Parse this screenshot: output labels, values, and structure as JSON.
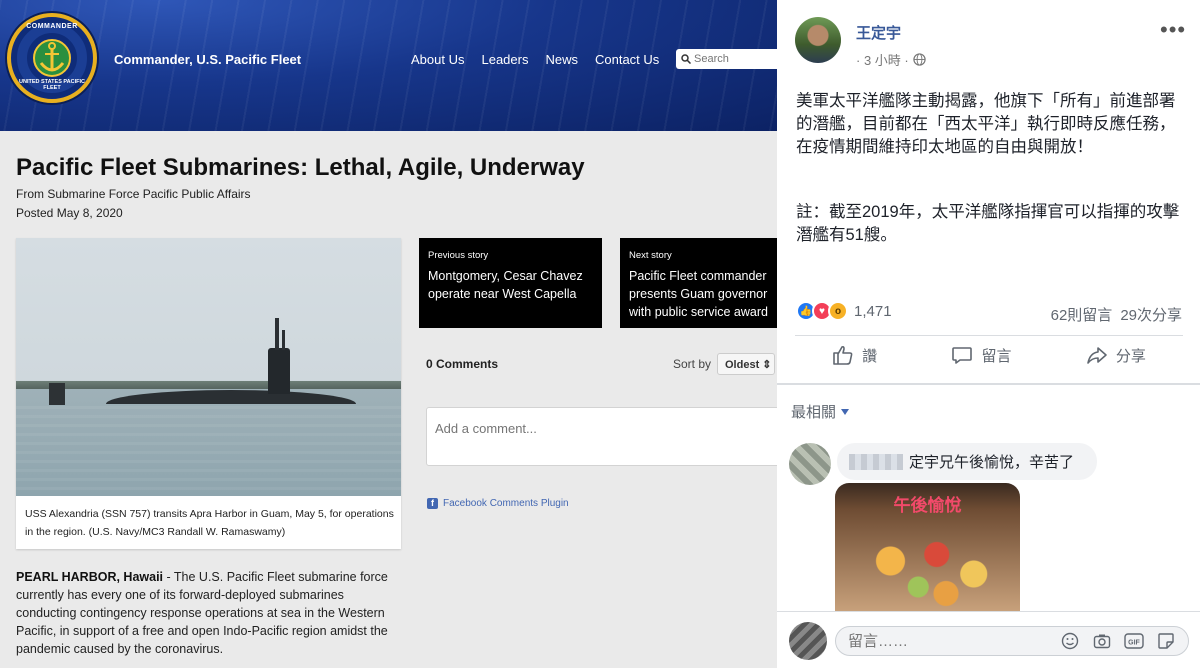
{
  "site": {
    "emblem_top": "COMMANDER",
    "emblem_bottom": "UNITED STATES PACIFIC FLEET",
    "name": "Commander, U.S. Pacific Fleet",
    "nav": [
      "About Us",
      "Leaders",
      "News",
      "Contact Us"
    ],
    "search_placeholder": "Search"
  },
  "article": {
    "title": "Pacific Fleet Submarines: Lethal, Agile, Underway",
    "byline": "From Submarine Force Pacific Public Affairs",
    "posted": "Posted May 8, 2020",
    "caption": "USS Alexandria (SSN 757) transits Apra Harbor in Guam, May 5, for operations in the region. (U.S. Navy/MC3 Randall W. Ramaswamy)",
    "dateline": "PEARL HARBOR, Hawaii",
    "body": " - The U.S. Pacific Fleet submarine force currently has every one of its forward-deployed submarines conducting contingency response operations at sea in the Western Pacific, in support of a free and open Indo-Pacific region amidst the pandemic caused by the coronavirus."
  },
  "stories": {
    "prev_label": "Previous story",
    "prev_title": "Montgomery, Cesar Chavez operate near West Capella",
    "next_label": "Next story",
    "next_title": "Pacific Fleet commander presents Guam governor with public service award"
  },
  "comments": {
    "count": "0 Comments",
    "sort_label": "Sort by",
    "sort_value": "Oldest",
    "placeholder": "Add a comment...",
    "plugin": "Facebook Comments Plugin"
  },
  "fb": {
    "poster": "王定宇",
    "time": "· 3 小時 ·",
    "text": "美軍太平洋艦隊主動揭露，他旗下「所有」前進部署的潛艦，目前都在「西太平洋」執行即時反應任務，在疫情期間維持印太地區的自由與開放！",
    "note": "註：截至2019年，太平洋艦隊指揮官可以指揮的攻擊潛艦有51艘。",
    "reaction_count": "1,471",
    "comments_count": "62則留言",
    "shares_count": "29次分享",
    "like": "讚",
    "comment": "留言",
    "share": "分享",
    "most_relevant": "最相關",
    "comment_text": "定宇兄午後愉悅，辛苦了",
    "comment_image_text": "午後愉悅",
    "composer_placeholder": "留言……"
  }
}
